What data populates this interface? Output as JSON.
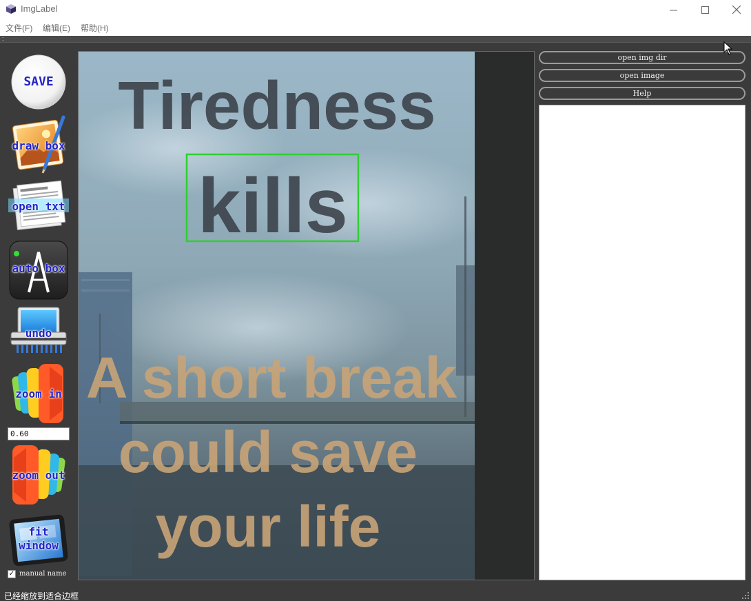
{
  "window": {
    "title": "ImgLabel"
  },
  "menu": {
    "file": "文件(F)",
    "edit": "编辑(E)",
    "help": "帮助(H)"
  },
  "tools": {
    "save": "SAVE",
    "draw_box": "draw box",
    "open_txt": "open txt",
    "auto_box": "auto box",
    "undo": "undo",
    "zoom_in": "zoom in",
    "zoom_value": "0.60",
    "zoom_out": "zoom out",
    "fit_window_line1": "fit",
    "fit_window_line2": "window",
    "manual_name": "manual name",
    "manual_name_checked": true
  },
  "side": {
    "open_img_dir": "open img dir",
    "open_image": "open image",
    "help": "Help"
  },
  "image_text": {
    "line1": "Tiredness",
    "line2": "kills",
    "line3": "A short break",
    "line4": "could save",
    "line5": "your life"
  },
  "annotation": {
    "box_color": "#2fd02f"
  },
  "status": "已经缩放到适合边框",
  "colors": {
    "background": "#3b3b3b",
    "accent_label": "#2424c8"
  }
}
